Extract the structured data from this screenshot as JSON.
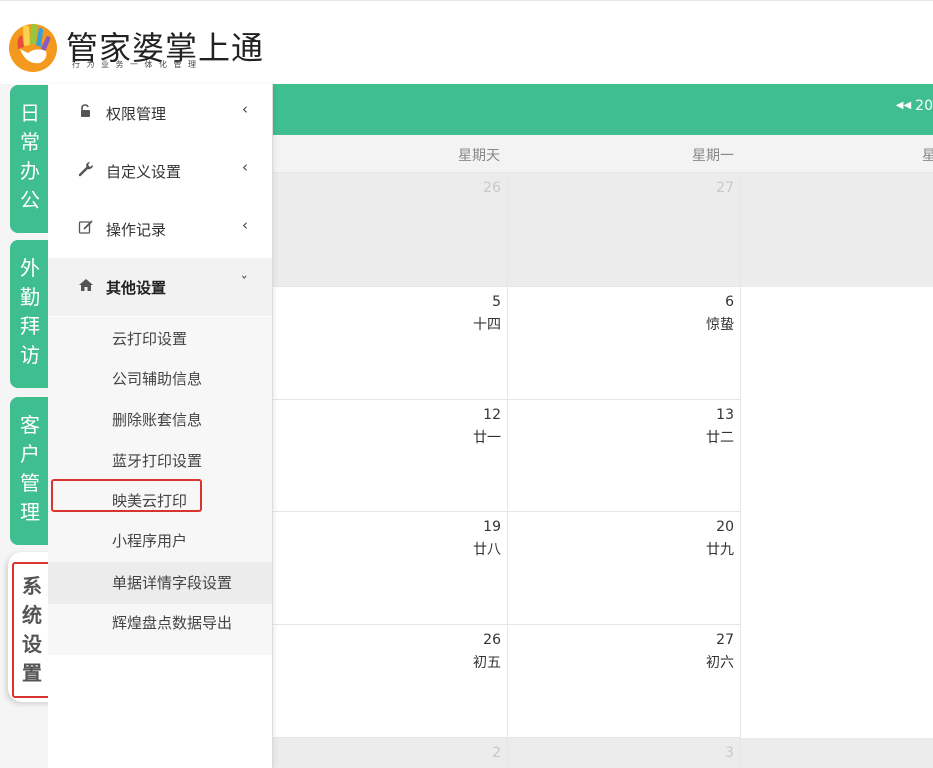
{
  "brand": {
    "title": "管家婆掌上通",
    "subtitle": "行为业务一体化管理"
  },
  "left_tabs": [
    {
      "label": "日常办公"
    },
    {
      "label": "外勤拜访"
    },
    {
      "label": "客户管理"
    },
    {
      "label": "系统设置",
      "active": true
    }
  ],
  "menu": {
    "items": [
      {
        "label": "权限管理",
        "icon": "lock-icon",
        "chevron": "‹"
      },
      {
        "label": "自定义设置",
        "icon": "wrench-icon",
        "chevron": "‹"
      },
      {
        "label": "操作记录",
        "icon": "edit-icon",
        "chevron": "‹"
      },
      {
        "label": "其他设置",
        "icon": "home-icon",
        "chevron": "ˇ",
        "expanded": true
      }
    ],
    "subitems": [
      {
        "label": "云打印设置"
      },
      {
        "label": "公司辅助信息"
      },
      {
        "label": "删除账套信息"
      },
      {
        "label": "蓝牙打印设置"
      },
      {
        "label": "映美云打印"
      },
      {
        "label": "小程序用户"
      },
      {
        "label": "单据详情字段设置",
        "highlighted": true
      },
      {
        "label": "辉煌盘点数据导出"
      }
    ]
  },
  "calendar": {
    "nav_text": "20",
    "nav_icon": "double-arrow-left-icon",
    "weekdays": [
      "星期天",
      "星期一",
      "星"
    ],
    "rows": [
      {
        "cells": [
          {
            "day": "26",
            "lunar": "",
            "dim": true
          },
          {
            "day": "27",
            "lunar": "",
            "dim": true
          }
        ]
      },
      {
        "cells": [
          {
            "day": "5",
            "lunar": "十四"
          },
          {
            "day": "6",
            "lunar": "惊蛰"
          }
        ]
      },
      {
        "cells": [
          {
            "day": "12",
            "lunar": "廿一"
          },
          {
            "day": "13",
            "lunar": "廿二"
          }
        ]
      },
      {
        "cells": [
          {
            "day": "19",
            "lunar": "廿八"
          },
          {
            "day": "20",
            "lunar": "廿九"
          }
        ]
      },
      {
        "cells": [
          {
            "day": "26",
            "lunar": "初五"
          },
          {
            "day": "27",
            "lunar": "初六"
          }
        ]
      },
      {
        "cells": [
          {
            "day": "2",
            "lunar": "",
            "dim": true
          },
          {
            "day": "3",
            "lunar": "",
            "dim": true
          }
        ]
      }
    ]
  },
  "colors": {
    "accent": "#3fbf8f",
    "highlight_border": "#d9352c"
  }
}
